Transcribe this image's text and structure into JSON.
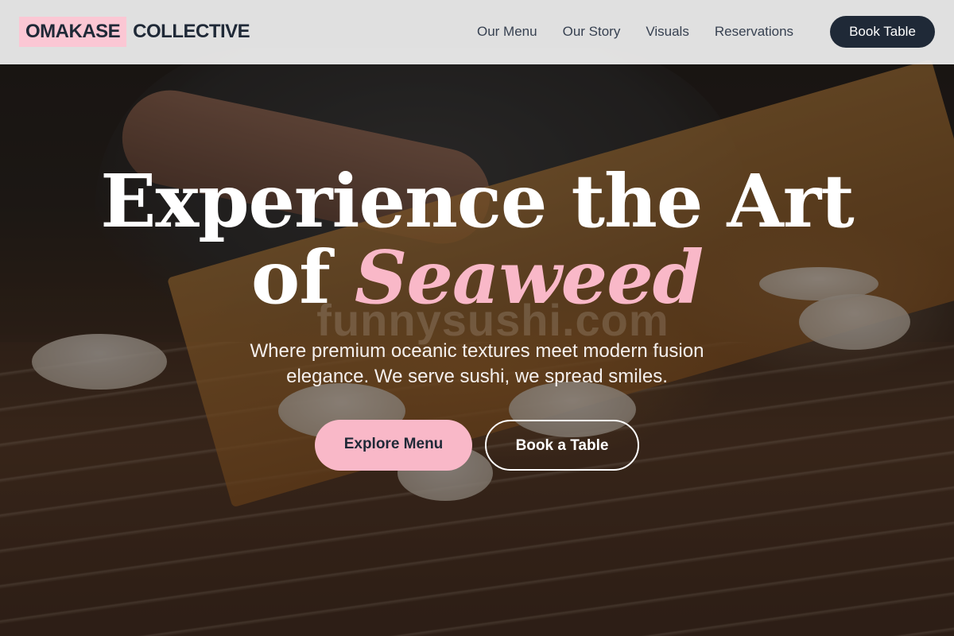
{
  "brand": {
    "name_highlight": "OMAKASE",
    "name_rest": "COLLECTIVE",
    "highlight_color": "#fbc7d4",
    "text_color": "#1f2937"
  },
  "nav": {
    "links": [
      "Our Menu",
      "Our Story",
      "Visuals",
      "Reservations"
    ],
    "cta_label": "Book Table"
  },
  "hero": {
    "headline_line1": "Experience the Art",
    "headline_line2_prefix": "of",
    "headline_line2_accent": "Seaweed",
    "accent_color": "#f9b8c8",
    "watermark": "funnysushi.com",
    "subtitle": "Where premium oceanic textures meet modern fusion elegance. We serve sushi, we spread smiles.",
    "primary_button": "Explore Menu",
    "secondary_button": "Book a Table"
  }
}
